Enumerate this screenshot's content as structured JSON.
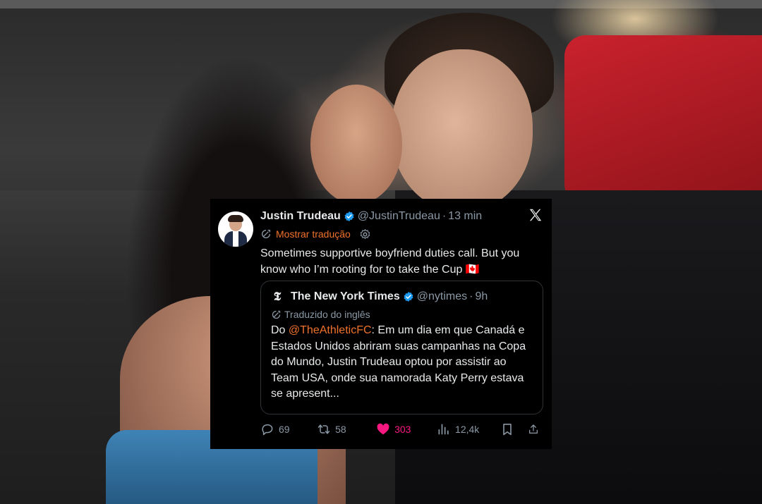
{
  "tweet": {
    "author_name": "Justin Trudeau",
    "author_handle": "@JustinTrudeau",
    "time": "13 min",
    "translate_label": "Mostrar tradução",
    "text": "Sometimes supportive boyfriend duties call. But you know who I’m rooting for to take the Cup 🇨🇦",
    "quote": {
      "author_name": "The New York Times",
      "author_handle": "@nytimes",
      "time": "9h",
      "translated_label": "Traduzido do inglês",
      "text_prefix": "Do ",
      "mention": "@TheAthleticFC",
      "text_rest": ": Em um dia em que Canadá e Estados Unidos abriram suas campanhas na Copa do Mundo, Justin Trudeau optou por assistir ao Team USA, onde sua namorada Katy Perry estava se apresent..."
    },
    "stats": {
      "replies": "69",
      "reposts": "58",
      "likes": "303",
      "views": "12,4k"
    },
    "colors": {
      "like": "#f91880",
      "link": "#f0722c",
      "verified": "#1d9bf0",
      "muted": "#8b98a5"
    },
    "icons": [
      "verified-badge-icon",
      "x-logo-icon",
      "translate-icon",
      "gear-icon",
      "nyt-logo-icon",
      "reply-icon",
      "repost-icon",
      "heart-icon",
      "views-icon",
      "bookmark-icon",
      "share-icon"
    ]
  }
}
